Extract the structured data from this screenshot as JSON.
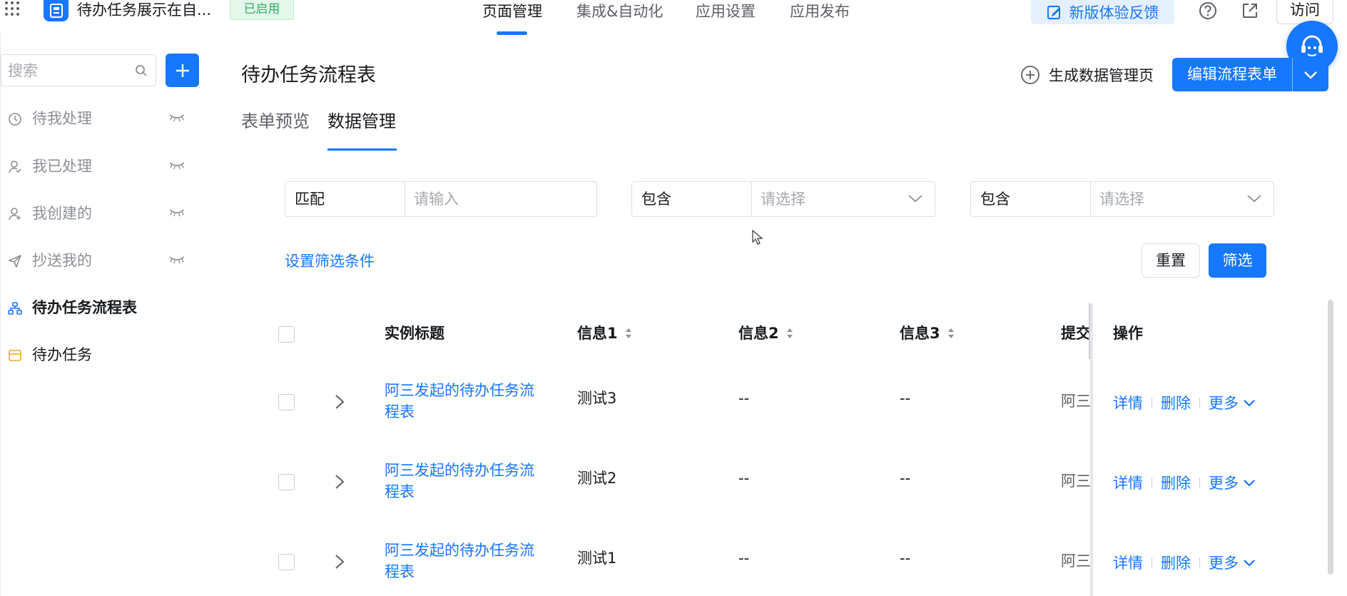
{
  "app": {
    "name": "待办任务展示在自...",
    "status": "已启用"
  },
  "nav": {
    "tabs": [
      "页面管理",
      "集成&自动化",
      "应用设置",
      "应用发布"
    ],
    "active_index": 0,
    "feedback_label": "新版体验反馈",
    "visit_label": "访问"
  },
  "sidebar": {
    "search_placeholder": "搜索",
    "items": [
      {
        "label": "待我处理",
        "icon": "clock-icon",
        "hidden": true
      },
      {
        "label": "我已处理",
        "icon": "user-check-icon",
        "hidden": true
      },
      {
        "label": "我创建的",
        "icon": "user-plus-icon",
        "hidden": true
      },
      {
        "label": "抄送我的",
        "icon": "send-icon",
        "hidden": true
      },
      {
        "label": "待办任务流程表",
        "icon": "flow-icon",
        "active": true
      },
      {
        "label": "待办任务",
        "icon": "form-icon"
      }
    ]
  },
  "main": {
    "title": "待办任务流程表",
    "generate_label": "生成数据管理页",
    "edit_label": "编辑流程表单",
    "tabs": [
      "表单预览",
      "数据管理"
    ],
    "active_tab": 1,
    "filters": [
      {
        "op": "匹配",
        "placeholder": "请输入",
        "type": "input"
      },
      {
        "op": "包含",
        "placeholder": "请选择",
        "type": "select"
      },
      {
        "op": "包含",
        "placeholder": "请选择",
        "type": "select"
      }
    ],
    "filter_setting_label": "设置筛选条件",
    "reset_label": "重置",
    "filter_label": "筛选"
  },
  "table": {
    "columns": [
      "实例标题",
      "信息1",
      "信息2",
      "信息3",
      "提交人",
      "操作"
    ],
    "rows": [
      {
        "title": "阿三发起的待办任务流程表",
        "info1": "测试3",
        "info2": "--",
        "info3": "--",
        "submitter": "阿三"
      },
      {
        "title": "阿三发起的待办任务流程表",
        "info1": "测试2",
        "info2": "--",
        "info3": "--",
        "submitter": "阿三"
      },
      {
        "title": "阿三发起的待办任务流程表",
        "info1": "测试1",
        "info2": "--",
        "info3": "--",
        "submitter": "阿三"
      }
    ],
    "actions": {
      "detail": "详情",
      "delete": "删除",
      "more": "更多"
    }
  },
  "colors": {
    "primary": "#1677ff",
    "success": "#2fb365",
    "text": "#171a1d",
    "muted": "#8c8f94"
  }
}
